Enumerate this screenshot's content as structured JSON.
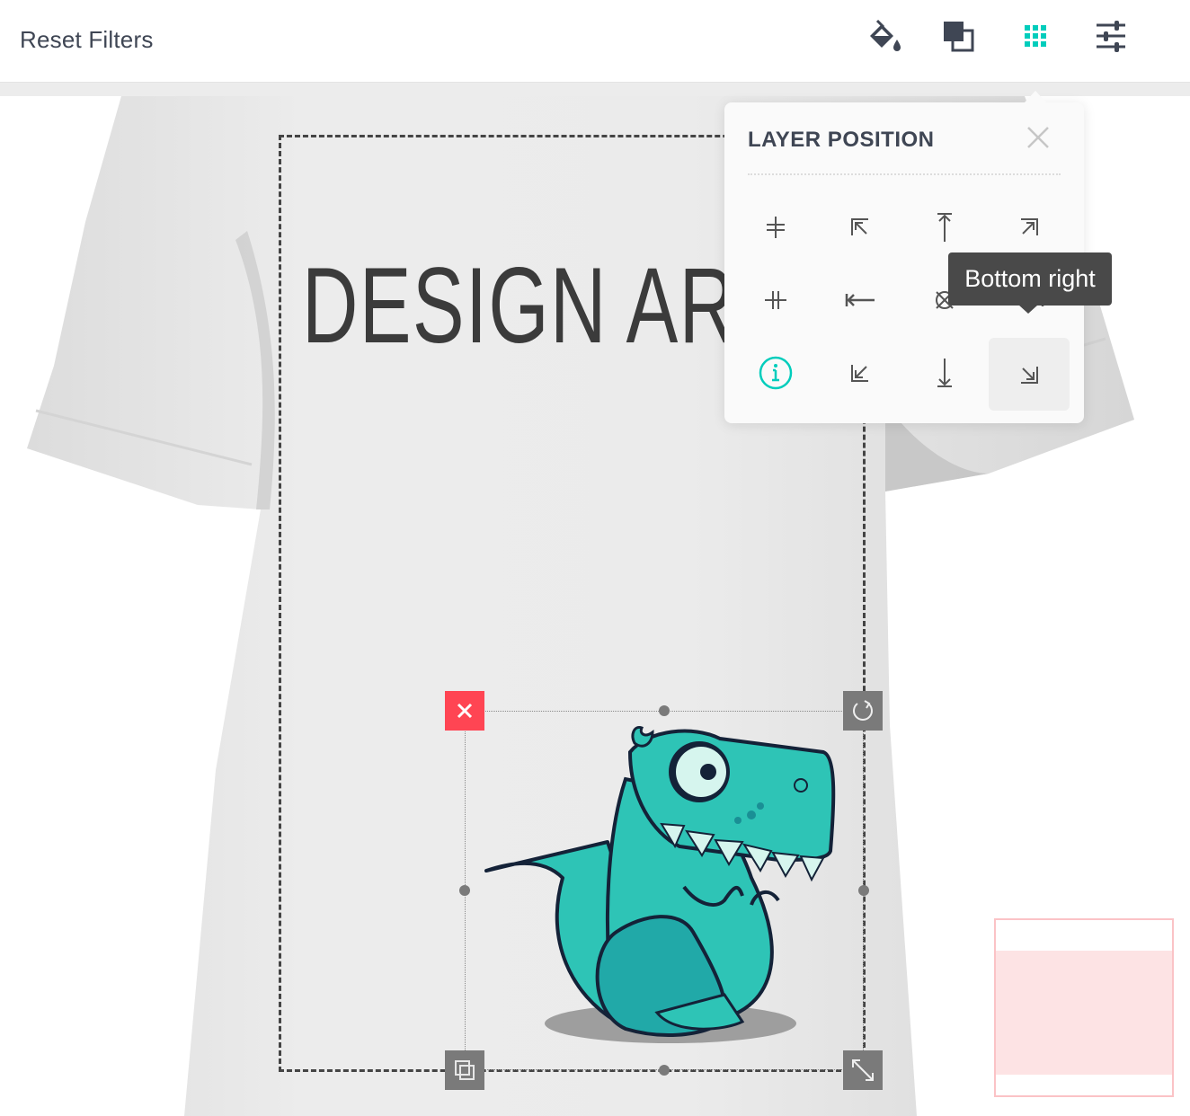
{
  "toolbar": {
    "reset_filters_label": "Reset Filters",
    "tools": [
      {
        "name": "fill-color",
        "icon": "paint-bucket-icon",
        "active": false
      },
      {
        "name": "arrange-layers",
        "icon": "layers-icon",
        "active": false
      },
      {
        "name": "layer-position",
        "icon": "grid-icon",
        "active": true
      },
      {
        "name": "filters",
        "icon": "sliders-icon",
        "active": false
      }
    ]
  },
  "colors": {
    "accent": "#00cdbc",
    "text": "#3f4654",
    "delete": "#ff4553",
    "handle": "#7a7a7a",
    "tooltip_bg": "#494949",
    "preview_border": "#fbc3c6",
    "preview_fill": "#fde3e4",
    "dino_body": "#2ec4b6"
  },
  "popover": {
    "title": "LAYER POSITION",
    "close_icon": "close-icon",
    "positions": [
      {
        "label": "Center horizontal",
        "icon": "align-center-horizontal-icon"
      },
      {
        "label": "Top left",
        "icon": "arrow-top-left-icon"
      },
      {
        "label": "Top center",
        "icon": "arrow-top-icon"
      },
      {
        "label": "Top right",
        "icon": "arrow-top-right-icon"
      },
      {
        "label": "Center vertical",
        "icon": "align-center-vertical-icon"
      },
      {
        "label": "Middle left",
        "icon": "arrow-left-icon"
      },
      {
        "label": "Center",
        "icon": "center-icon"
      },
      {
        "label": "Middle right",
        "icon": "arrow-right-icon"
      },
      {
        "label": "Info",
        "icon": "info-icon"
      },
      {
        "label": "Bottom left",
        "icon": "arrow-bottom-left-icon"
      },
      {
        "label": "Bottom center",
        "icon": "arrow-bottom-icon"
      },
      {
        "label": "Bottom right",
        "icon": "arrow-bottom-right-icon"
      }
    ],
    "active_position": "Bottom right"
  },
  "tooltip": {
    "text": "Bottom right"
  },
  "canvas": {
    "text_layer": "DESIGN AR",
    "image_layer": "dinosaur-clipart",
    "selection_controls": {
      "delete": "close-icon",
      "rotate": "rotate-icon",
      "duplicate": "duplicate-icon",
      "resize": "resize-icon"
    }
  }
}
